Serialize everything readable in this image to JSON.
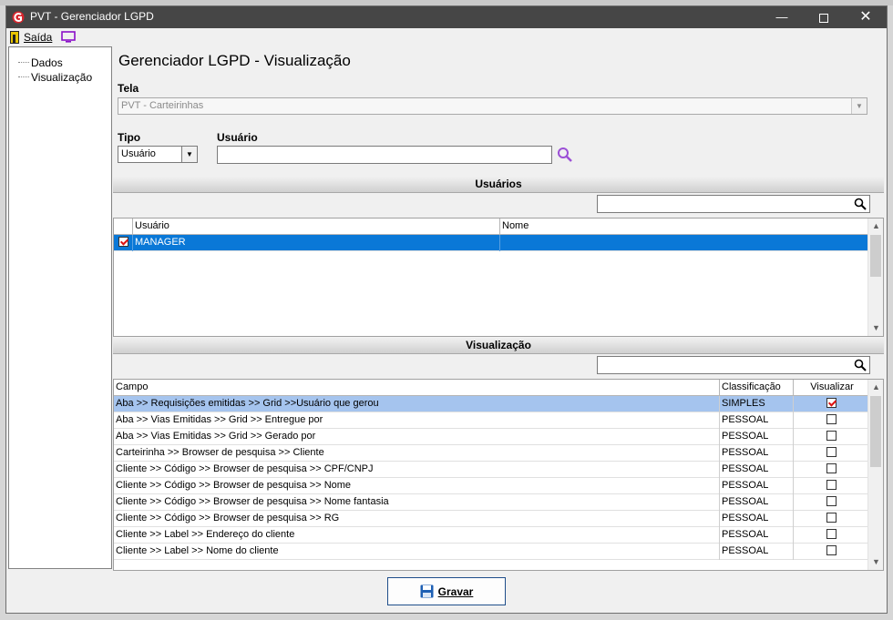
{
  "window": {
    "title": "PVT - Gerenciador LGPD",
    "minimize_glyph": "—",
    "close_glyph": "✕"
  },
  "menu": {
    "exit_label": "Saída",
    "exit_icon": "exit-door-icon",
    "monitor_icon": "monitor-icon"
  },
  "tree": {
    "items": [
      {
        "label": "Dados"
      },
      {
        "label": "Visualização"
      }
    ]
  },
  "main": {
    "title": "Gerenciador LGPD - Visualização",
    "tela_label": "Tela",
    "tela_value": "PVT - Carteirinhas",
    "tipo_label": "Tipo",
    "tipo_value": "Usuário",
    "usuario_label": "Usuário",
    "usuario_value": ""
  },
  "users_section": {
    "header": "Usuários",
    "search_value": "",
    "columns": [
      "Usuário",
      "Nome"
    ],
    "rows": [
      {
        "checked": true,
        "usuario": "MANAGER",
        "nome": ""
      }
    ]
  },
  "view_section": {
    "header": "Visualização",
    "search_value": "",
    "columns": [
      "Campo",
      "Classificação",
      "Visualizar"
    ],
    "rows": [
      {
        "campo": "Aba >> Requisições emitidas  >> Grid >>Usuário que gerou",
        "classificacao": "SIMPLES",
        "visualizar": true
      },
      {
        "campo": "Aba >> Vias Emitidas >> Grid >> Entregue por",
        "classificacao": "PESSOAL",
        "visualizar": false
      },
      {
        "campo": "Aba >> Vias Emitidas >> Grid >> Gerado por",
        "classificacao": "PESSOAL",
        "visualizar": false
      },
      {
        "campo": "Carteirinha >> Browser de pesquisa >> Cliente",
        "classificacao": "PESSOAL",
        "visualizar": false
      },
      {
        "campo": "Cliente >> Código >> Browser de pesquisa >> CPF/CNPJ",
        "classificacao": "PESSOAL",
        "visualizar": false
      },
      {
        "campo": "Cliente >> Código >> Browser de pesquisa >> Nome",
        "classificacao": "PESSOAL",
        "visualizar": false
      },
      {
        "campo": "Cliente >> Código >> Browser de pesquisa >> Nome fantasia",
        "classificacao": "PESSOAL",
        "visualizar": false
      },
      {
        "campo": "Cliente >> Código >> Browser de pesquisa >> RG",
        "classificacao": "PESSOAL",
        "visualizar": false
      },
      {
        "campo": "Cliente >> Label >> Endereço do cliente",
        "classificacao": "PESSOAL",
        "visualizar": false
      },
      {
        "campo": "Cliente >> Label >> Nome do cliente",
        "classificacao": "PESSOAL",
        "visualizar": false
      }
    ]
  },
  "footer": {
    "save_label": "Gravar",
    "save_icon": "floppy-disk-icon"
  },
  "colors": {
    "titlebar": "#464646",
    "selection_blue": "#0a78d7",
    "selection_light": "#a5c4ee",
    "search_icon_purple": "#9b4fd6"
  }
}
